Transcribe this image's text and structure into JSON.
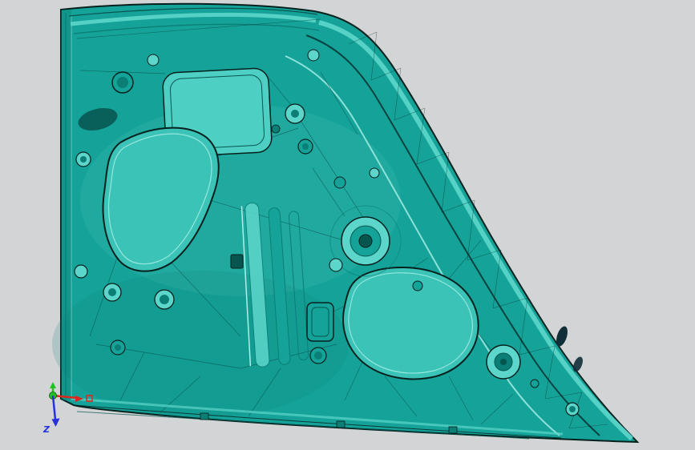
{
  "scene": {
    "triad": {
      "z_label": "Z",
      "x_color": "#d9291c",
      "y_color": "#23c023",
      "z_color": "#2631dd"
    },
    "colors": {
      "background": "#d3d4d6",
      "part_mid": "#15a399",
      "part_deep": "#0b7e76",
      "part_darker": "#07554f",
      "part_light": "#5cd6ca",
      "part_lighter": "#aaf0e7",
      "cutout": "#3cc3b7",
      "edge": "#05211e",
      "slot_dark": "#102e37"
    }
  }
}
